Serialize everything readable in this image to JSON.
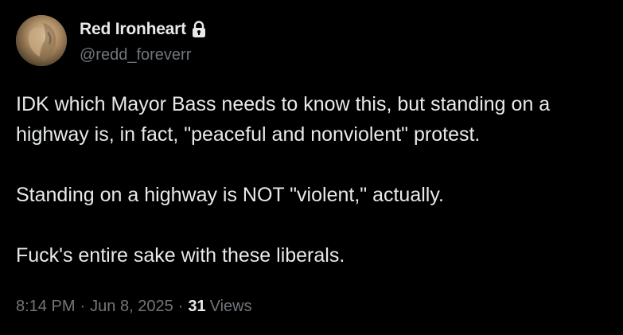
{
  "author": {
    "display_name": "Red Ironheart",
    "handle": "@redd_foreverr",
    "locked_icon": "lock-icon",
    "avatar_icon": "profile-avatar"
  },
  "post": {
    "paragraphs": [
      "IDK which Mayor Bass needs to know this, but standing on a\nhighway is, in fact, \"peaceful and nonviolent\" protest.",
      "Standing on a highway is NOT \"violent,\" actually.",
      "Fuck's entire sake with these liberals."
    ]
  },
  "meta": {
    "time": "8:14 PM",
    "separator": "·",
    "date": "Jun 8, 2025",
    "views_count": "31",
    "views_label": "Views"
  },
  "colors": {
    "background": "#000000",
    "primary_text": "#e7e9ea",
    "secondary_text": "#71767b"
  }
}
